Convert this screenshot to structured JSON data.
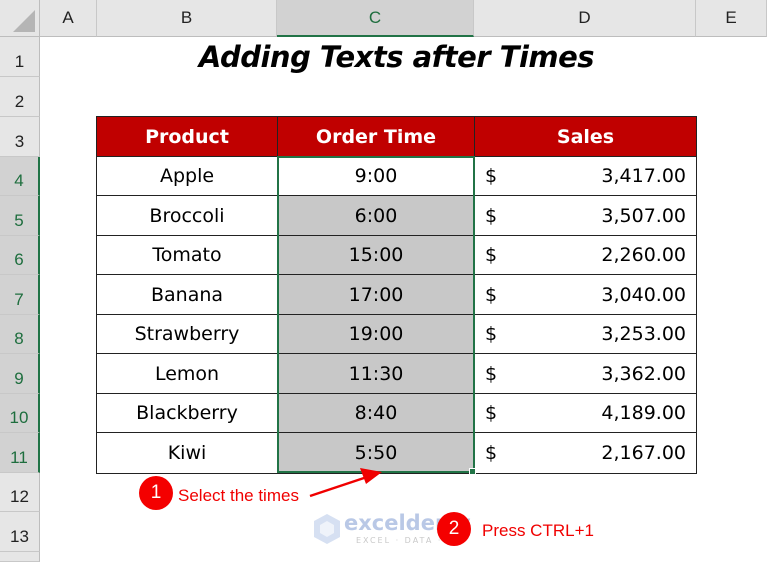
{
  "columns": [
    "A",
    "B",
    "C",
    "D",
    "E"
  ],
  "selected_column": "C",
  "rows": [
    "1",
    "2",
    "3",
    "4",
    "5",
    "6",
    "7",
    "8",
    "9",
    "10",
    "11",
    "12",
    "13"
  ],
  "selected_rows": [
    "4",
    "5",
    "6",
    "7",
    "8",
    "9",
    "10",
    "11"
  ],
  "title": "Adding Texts after Times",
  "table": {
    "headers": [
      "Product",
      "Order Time",
      "Sales"
    ],
    "rows": [
      {
        "product": "Apple",
        "time": "9:00",
        "currency": "$",
        "sales": "3,417.00"
      },
      {
        "product": "Broccoli",
        "time": "6:00",
        "currency": "$",
        "sales": "3,507.00"
      },
      {
        "product": "Tomato",
        "time": "15:00",
        "currency": "$",
        "sales": "2,260.00"
      },
      {
        "product": "Banana",
        "time": "17:00",
        "currency": "$",
        "sales": "3,040.00"
      },
      {
        "product": "Strawberry",
        "time": "19:00",
        "currency": "$",
        "sales": "3,253.00"
      },
      {
        "product": "Lemon",
        "time": "11:30",
        "currency": "$",
        "sales": "3,362.00"
      },
      {
        "product": "Blackberry",
        "time": "8:40",
        "currency": "$",
        "sales": "4,189.00"
      },
      {
        "product": "Kiwi",
        "time": "5:50",
        "currency": "$",
        "sales": "2,167.00"
      }
    ]
  },
  "annotations": [
    {
      "number": "1",
      "text": "Select the times"
    },
    {
      "number": "2",
      "text": "Press CTRL+1"
    }
  ],
  "watermark": {
    "name": "exceldemy",
    "tagline": "EXCEL · DATA · BI"
  },
  "colors": {
    "header_fill": "#c00000",
    "selection": "#217346",
    "highlight_fill": "#c8c8c8",
    "annotation": "#f40000"
  }
}
